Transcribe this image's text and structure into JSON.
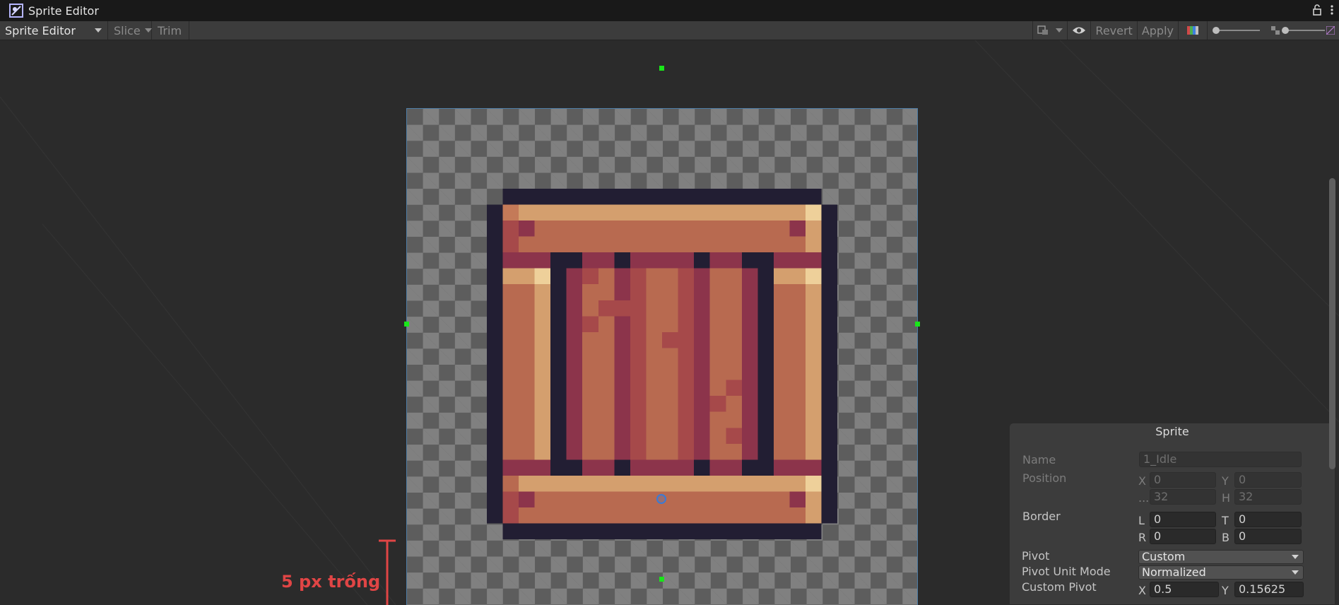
{
  "window": {
    "title": "Sprite Editor"
  },
  "toolbar": {
    "mode_dropdown": "Sprite Editor",
    "slice_label": "Slice",
    "trim_label": "Trim",
    "revert_label": "Revert",
    "apply_label": "Apply"
  },
  "annotation": {
    "label": "5 px trống",
    "color": "#e04545"
  },
  "sprite_panel": {
    "title": "Sprite",
    "name_label": "Name",
    "name_value": "1_Idle",
    "position_label": "Position",
    "pos_x_axis": "X",
    "pos_x_value": "0",
    "pos_y_axis": "Y",
    "pos_y_value": "0",
    "pos_w_axis": "...",
    "pos_w_value": "32",
    "pos_h_axis": "H",
    "pos_h_value": "32",
    "border_label": "Border",
    "border_l_axis": "L",
    "border_l_value": "0",
    "border_t_axis": "T",
    "border_t_value": "0",
    "border_r_axis": "R",
    "border_r_value": "0",
    "border_b_axis": "B",
    "border_b_value": "0",
    "pivot_label": "Pivot",
    "pivot_value": "Custom",
    "pivot_unit_label": "Pivot Unit Mode",
    "pivot_unit_value": "Normalized",
    "custom_pivot_label": "Custom Pivot",
    "custom_x_axis": "X",
    "custom_x_value": "0.5",
    "custom_y_axis": "Y",
    "custom_y_value": "0.15625"
  },
  "colors": {
    "outline": "#221e33",
    "wood": "#b86a50",
    "highlight": "#d49f6e",
    "shadow": "#8c344b",
    "spot": "#a6494a",
    "light": "#eed09a",
    "selection_border": "#4f7fa8",
    "handle": "#19e619"
  }
}
